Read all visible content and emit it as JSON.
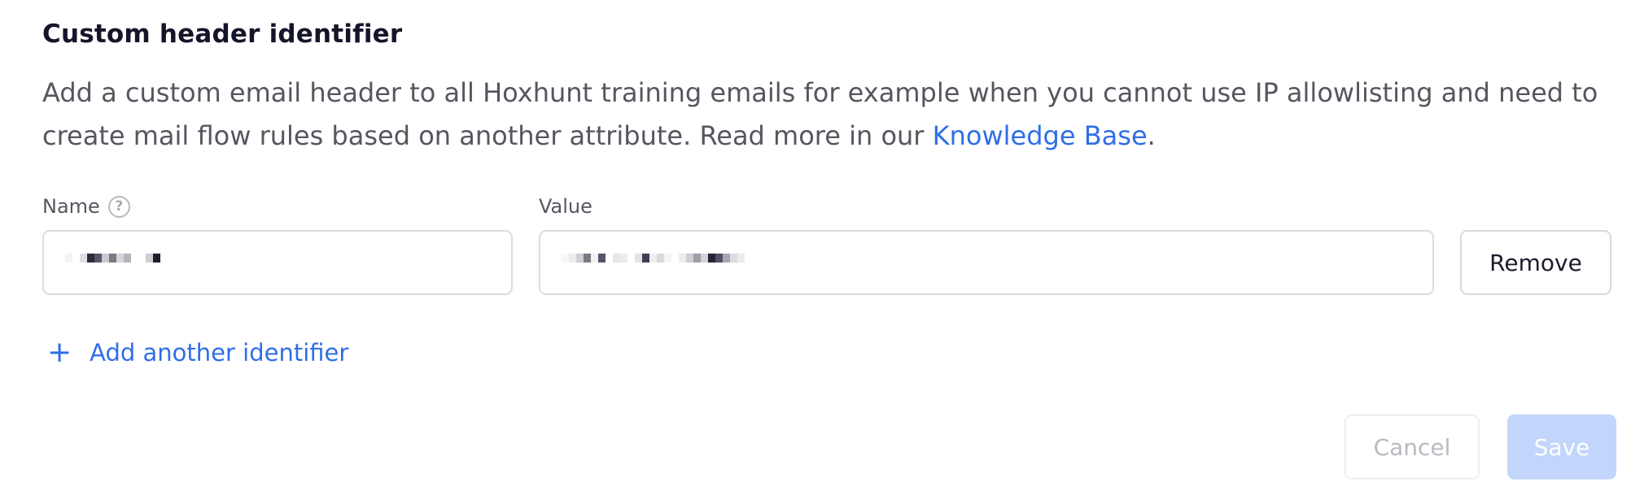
{
  "section": {
    "title": "Custom header identifier",
    "description_text": "Add a custom email header to all Hoxhunt training emails for example when you cannot use IP allowlisting and need to create mail flow rules based on another attribute. Read more in our ",
    "knowledge_base_link": "Knowledge Base",
    "description_end": "."
  },
  "fields": {
    "name_label": "Name",
    "value_label": "Value",
    "help_icon": "question-circle-icon",
    "name_value_redacted": true,
    "value_value_redacted": true
  },
  "actions": {
    "remove_label": "Remove",
    "add_identifier_label": "Add another identifier",
    "add_icon": "plus-icon",
    "cancel_label": "Cancel",
    "save_label": "Save"
  },
  "colors": {
    "link": "#2f6ee8",
    "save_disabled": "#c2d5fb",
    "text_muted": "#55565f"
  }
}
